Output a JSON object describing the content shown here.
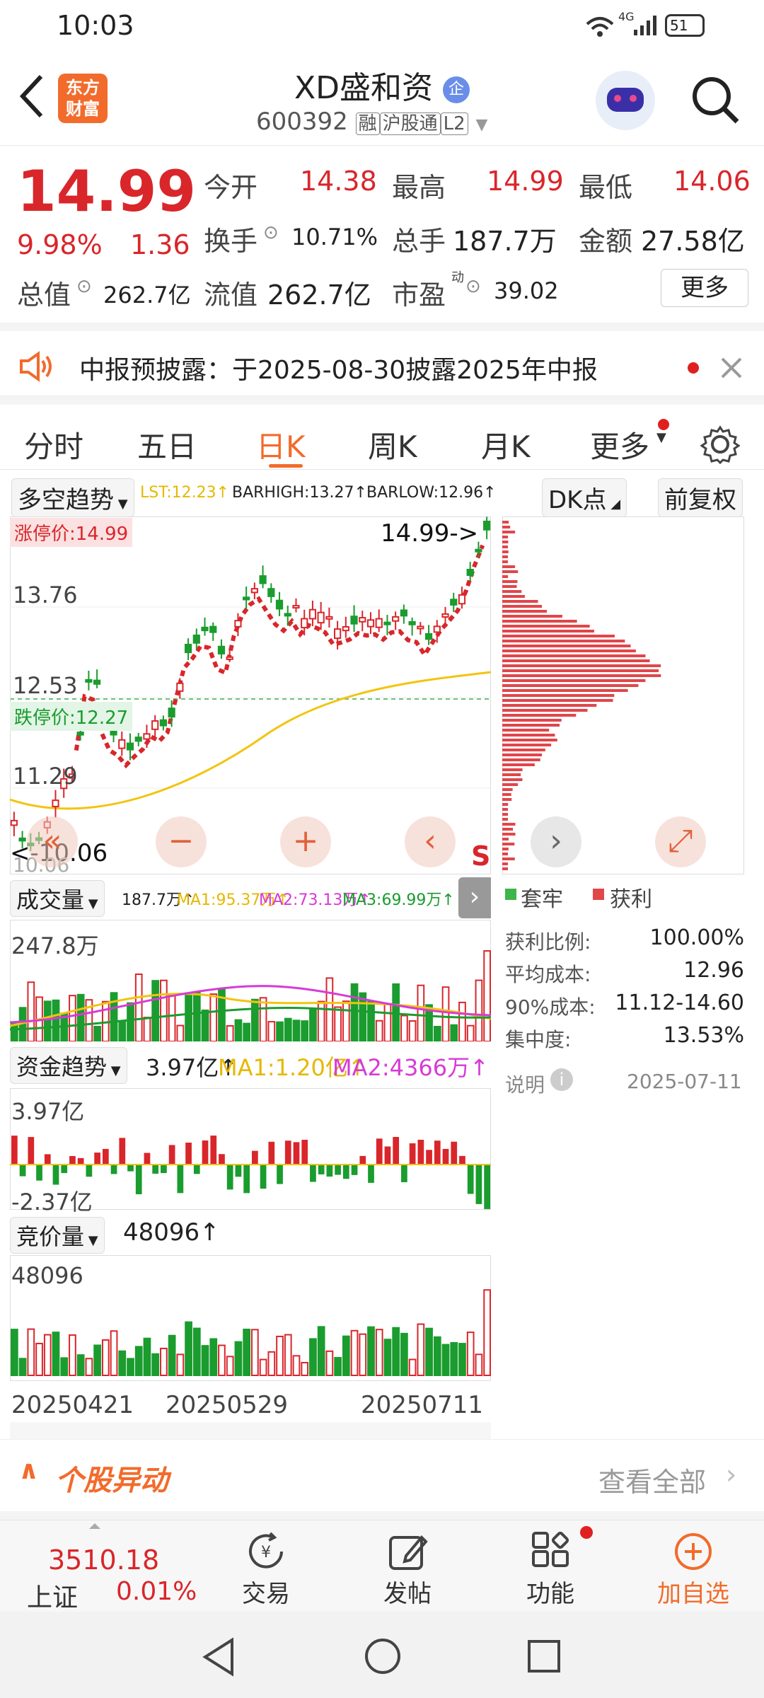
{
  "status": {
    "time": "10:03",
    "battery": "51",
    "net": "4G"
  },
  "header": {
    "title": "XD盛和资",
    "code": "600392",
    "tags": [
      "融",
      "沪股通",
      "L2"
    ],
    "logo_line1": "东方",
    "logo_line2": "财富",
    "badge": "企"
  },
  "quote": {
    "price": "14.99",
    "pct": "9.98%",
    "chg": "1.36",
    "fields": [
      {
        "label": "今开",
        "value": "14.38"
      },
      {
        "label": "最高",
        "value": "14.99"
      },
      {
        "label": "最低",
        "value": "14.06"
      },
      {
        "label": "换手",
        "value": "10.71%"
      },
      {
        "label": "总手",
        "value": "187.7万"
      },
      {
        "label": "金额",
        "value": "27.58亿"
      },
      {
        "label": "总值",
        "value": "262.7亿"
      },
      {
        "label": "流值",
        "value": "262.7亿"
      },
      {
        "label": "市盈",
        "value": "39.02",
        "sup": "动"
      }
    ],
    "more": "更多"
  },
  "notice": {
    "text": "中报预披露：于2025-08-30披露2025年中报"
  },
  "tabs": [
    "分时",
    "五日",
    "日K",
    "周K",
    "月K",
    "更多"
  ],
  "active_tab": "日K",
  "kline": {
    "indicator": "多空趋势",
    "lst": "LST:12.23↑",
    "barhigh": "BARHIGH:13.27↑",
    "barlow": "BARLOW:12.96↑",
    "dk_button": "DK点",
    "adjust_button": "前复权",
    "limit_up": "涨停价:14.99",
    "limit_down": "跌停价:12.27",
    "max_marker": "14.99->",
    "min_marker": "<-10.06",
    "y_labels": [
      "13.76",
      "12.53",
      "11.29",
      "10.06"
    ],
    "s_mark": "S"
  },
  "volume": {
    "name": "成交量",
    "value": "187.7万↑",
    "ma1": "MA1:95.37万↑",
    "ma2": "MA2:73.13万↑",
    "ma3": "MA3:69.99万↑",
    "top": "247.8万"
  },
  "fund": {
    "name": "资金趋势",
    "value": "3.97亿↑",
    "ma1": "MA1:1.20亿↑",
    "ma2": "MA2:4366万↑",
    "top": "3.97亿",
    "bottom": "-2.37亿"
  },
  "auction": {
    "name": "竞价量",
    "value": "48096↑",
    "top": "48096"
  },
  "dates": [
    "20250421",
    "20250529",
    "20250711"
  ],
  "chip": {
    "legend_trapped": "套牢",
    "legend_profit": "获利",
    "rows": [
      {
        "label": "获利比例:",
        "value": "100.00%"
      },
      {
        "label": "平均成本:",
        "value": "12.96"
      },
      {
        "label": "90%成本:",
        "value": "11.12-14.60"
      },
      {
        "label": "集中度:",
        "value": "13.53%"
      }
    ],
    "note": "说明",
    "date": "2025-07-11"
  },
  "movement": {
    "title": "个股异动",
    "link": "查看全部"
  },
  "bottom": {
    "index_value": "3510.18",
    "index_name": "上证",
    "index_pct": "0.01%",
    "items": [
      "交易",
      "发帖",
      "功能",
      "加自选"
    ]
  },
  "colors": {
    "up": "#d9262b",
    "down": "#1a9c2e",
    "brand": "#f26b2b",
    "ma_yellow": "#f2c40f",
    "ma_magenta": "#d63bd6"
  }
}
